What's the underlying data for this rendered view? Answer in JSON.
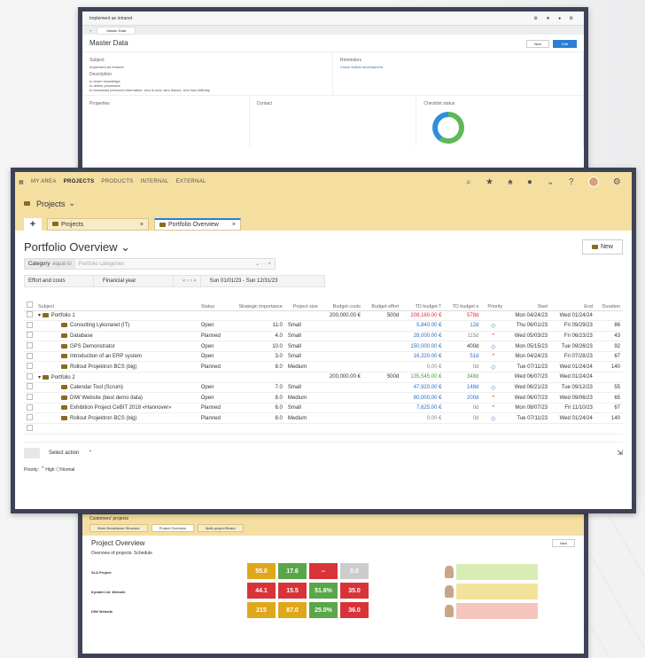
{
  "shotA": {
    "app_title": "Implement an intranet",
    "tab": "Master Data",
    "title": "Master Data",
    "buttons": {
      "new": "New",
      "save": "Edit"
    },
    "subject_label": "Subject",
    "subject_value": "Implement an intranet",
    "description_label": "Description",
    "description_lines": [
      "to share knowledge",
      "to define processes",
      "to broadcast personal information: who is new, who leaves, who has birthday"
    ],
    "reminders_label": "Reminders",
    "reminder_item": "Check further development",
    "properties_label": "Properties",
    "contact_label": "Contact",
    "checklist_label": "Checklist status"
  },
  "nav": {
    "items": [
      "MY AREA",
      "PROJECTS",
      "PRODUCTS",
      "INTERNAL",
      "EXTERNAL"
    ],
    "active": "PROJECTS"
  },
  "header": {
    "section": "Projects",
    "tabs": [
      {
        "label": "Projects"
      },
      {
        "label": "Portfolio Overview"
      }
    ]
  },
  "page": {
    "title": "Portfolio Overview",
    "new_button": "New",
    "filter_label": "Category",
    "filter_op": "equal to",
    "filter_placeholder": "Portfolio categories",
    "effort_label": "Effort and costs",
    "period_label": "Financial year",
    "period_range": "Sun 01/01/23 - Sun 12/31/23"
  },
  "table": {
    "columns": [
      "Subject",
      "Status",
      "Strategic importance",
      "Project size",
      "Budget costs",
      "Budget effort",
      "TD budget T",
      "TD budget e",
      "Priority",
      "Start",
      "End",
      "Duration"
    ],
    "rows": [
      {
        "type": "portfolio",
        "subject": "Portfolio 1",
        "status": "",
        "imp": "",
        "size": "",
        "bcost": "200,000.00 €",
        "beff": "500d",
        "tdt": "208,160.00 €",
        "tdt_cls": "red",
        "tde": "578d",
        "tde_cls": "red",
        "prio": "",
        "start": "Mon 04/24/23",
        "end": "Wed 01/24/24",
        "dur": ""
      },
      {
        "type": "project",
        "subject": "Consulting Lykoranet (IT)",
        "status": "Open",
        "imp": "11.0",
        "size": "Small",
        "bcost": "",
        "beff": "",
        "tdt": "5,840.00 €",
        "tdt_cls": "bl",
        "tde": "12d",
        "tde_cls": "bl",
        "prio": "normal",
        "start": "Thu 06/01/23",
        "end": "Fri 09/29/23",
        "dur": "86"
      },
      {
        "type": "project",
        "subject": "Database",
        "status": "Planned",
        "imp": "4.0",
        "size": "Small",
        "bcost": "",
        "beff": "",
        "tdt": "28,000.00 €",
        "tdt_cls": "bl",
        "tde": "115d",
        "tde_cls": "gray",
        "prio": "high",
        "start": "Wed 05/03/23",
        "end": "Fri 06/23/23",
        "dur": "43"
      },
      {
        "type": "project",
        "subject": "GPS Demonstrator",
        "status": "Open",
        "imp": "10.0",
        "size": "Small",
        "bcost": "",
        "beff": "",
        "tdt": "150,000.00 €",
        "tdt_cls": "bl",
        "tde": "400d",
        "tde_cls": "",
        "prio": "normal",
        "start": "Mon 05/15/23",
        "end": "Tue 09/26/23",
        "dur": "92"
      },
      {
        "type": "project",
        "subject": "Introduction of an ERP system",
        "status": "Open",
        "imp": "3.0",
        "size": "Small",
        "bcost": "",
        "beff": "",
        "tdt": "16,320.00 €",
        "tdt_cls": "bl",
        "tde": "51d",
        "tde_cls": "bl",
        "prio": "high",
        "start": "Mon 04/24/23",
        "end": "Fri 07/28/23",
        "dur": "67"
      },
      {
        "type": "project",
        "subject": "Rollout Projektron BCS (big)",
        "status": "Planned",
        "imp": "8.0",
        "size": "Medium",
        "bcost": "",
        "beff": "",
        "tdt": "0.00 €",
        "tdt_cls": "gray",
        "tde": "0d",
        "tde_cls": "gray",
        "prio": "normal",
        "start": "Tue 07/11/23",
        "end": "Wed 01/24/24",
        "dur": "140"
      },
      {
        "type": "portfolio",
        "subject": "Portfolio 2",
        "status": "",
        "imp": "",
        "size": "",
        "bcost": "200,000.00 €",
        "beff": "500d",
        "tdt": "135,545.00 €",
        "tdt_cls": "green",
        "tde": "348d",
        "tde_cls": "green",
        "prio": "",
        "start": "Wed 06/07/23",
        "end": "Wed 01/24/24",
        "dur": ""
      },
      {
        "type": "project",
        "subject": "Calendar Tool (Scrum)",
        "status": "Open",
        "imp": "7.0",
        "size": "Small",
        "bcost": "",
        "beff": "",
        "tdt": "47,920.00 €",
        "tdt_cls": "bl",
        "tde": "148d",
        "tde_cls": "bl",
        "prio": "normal",
        "start": "Wed 06/21/23",
        "end": "Tue 09/12/23",
        "dur": "55"
      },
      {
        "type": "project",
        "subject": "DIW Website (best demo data)",
        "status": "Open",
        "imp": "8.0",
        "size": "Medium",
        "bcost": "",
        "beff": "",
        "tdt": "80,000.00 €",
        "tdt_cls": "bl",
        "tde": "200d",
        "tde_cls": "bl",
        "prio": "high",
        "start": "Wed 06/07/23",
        "end": "Wed 09/06/23",
        "dur": "65"
      },
      {
        "type": "project",
        "subject": "Exhibition Project CeBIT 2018 «Hannover»",
        "status": "Planned",
        "imp": "6.0",
        "size": "Small",
        "bcost": "",
        "beff": "",
        "tdt": "7,625.00 €",
        "tdt_cls": "bl",
        "tde": "0d",
        "tde_cls": "gray",
        "prio": "high",
        "start": "Mon 08/07/23",
        "end": "Fri 11/10/23",
        "dur": "67"
      },
      {
        "type": "project",
        "subject": "Rollout Projektron BCS (big)",
        "status": "Planned",
        "imp": "8.0",
        "size": "Medium",
        "bcost": "",
        "beff": "",
        "tdt": "0.00 €",
        "tdt_cls": "gray",
        "tde": "0d",
        "tde_cls": "gray",
        "prio": "normal",
        "start": "Tue 07/11/23",
        "end": "Wed 01/24/24",
        "dur": "140"
      }
    ]
  },
  "footer": {
    "select_action": "Select action",
    "priority_label": "Priority",
    "high": "High",
    "normal": "Normal"
  },
  "shotC": {
    "breadcrumb": "Customers' projects",
    "tabs": [
      "Work Breakdown Structure",
      "Project Overview",
      "Multi-project Board"
    ],
    "title": "Project Overview",
    "subtitle": "Overview of projects: Schedule",
    "new_button": "New",
    "projects": [
      {
        "name": "SLA Project",
        "tiles": [
          "55.0",
          "17.6",
          "--",
          "0.0"
        ],
        "colors": [
          "#e0a71c",
          "#5aa64a",
          "#d9333a",
          "#cccccc"
        ]
      },
      {
        "name": "Kyrabit Ltd. Website",
        "tiles": [
          "44.1",
          "15.5",
          "51.6%",
          "35.0"
        ],
        "colors": [
          "#d9333a",
          "#d9333a",
          "#5aa64a",
          "#d9333a"
        ]
      },
      {
        "name": "DIW Website",
        "tiles": [
          "215",
          "87.0",
          "25.0%",
          "36.0"
        ],
        "colors": [
          "#e0a71c",
          "#e0a71c",
          "#5aa64a",
          "#d9333a"
        ]
      }
    ]
  }
}
